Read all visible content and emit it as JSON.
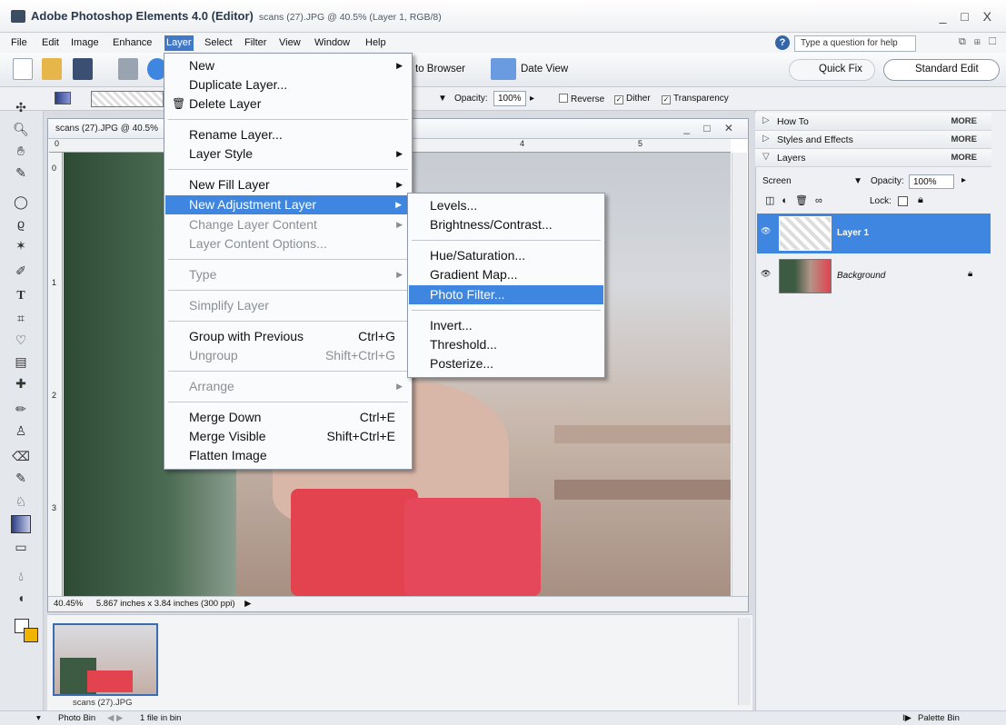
{
  "window": {
    "app_title": "Adobe Photoshop Elements 4.0 (Editor)",
    "doc_info": "scans (27).JPG @ 40.5% (Layer 1, RGB/8)",
    "controls": "_ □ X"
  },
  "menubar": {
    "items": [
      "File",
      "Edit",
      "Image",
      "Enhance",
      "Layer",
      "Select",
      "Filter",
      "View",
      "Window",
      "Help"
    ],
    "help_placeholder": "Type a question for help",
    "right_icons": "⧉ ⊞ ☐"
  },
  "toolbar": {
    "photo_browser": "to Browser",
    "date_view": "Date View",
    "quick_fix": "Quick Fix",
    "standard_edit": "Standard Edit"
  },
  "options": {
    "opacity_label": "Opacity:",
    "opacity_value": "100%",
    "reverse": "Reverse",
    "dither": "Dither",
    "transparency": "Transparency"
  },
  "document": {
    "title": "scans (27).JPG @ 40.5%",
    "zoom": "40.45%",
    "size_info": "5.867 inches x 3.84 inches (300 ppi)",
    "ruler_top": [
      "0",
      "4",
      "5"
    ],
    "ruler_left": [
      "0",
      "1",
      "2",
      "3"
    ]
  },
  "layer_menu": {
    "items": [
      {
        "label": "New",
        "submenu": true
      },
      {
        "label": "Duplicate Layer..."
      },
      {
        "label": "Delete Layer"
      },
      {
        "label": "Rename Layer..."
      },
      {
        "label": "Layer Style",
        "submenu": true
      },
      {
        "label": "New Fill Layer",
        "submenu": true
      },
      {
        "label": "New Adjustment Layer",
        "submenu": true
      },
      {
        "label": "Change Layer Content",
        "submenu": true
      },
      {
        "label": "Layer Content Options..."
      },
      {
        "label": "Type",
        "submenu": true
      },
      {
        "label": "Simplify Layer"
      },
      {
        "label": "Group with Previous",
        "shortcut": "Ctrl+G"
      },
      {
        "label": "Ungroup",
        "shortcut": "Shift+Ctrl+G"
      },
      {
        "label": "Arrange",
        "submenu": true
      },
      {
        "label": "Merge Down",
        "shortcut": "Ctrl+E"
      },
      {
        "label": "Merge Visible",
        "shortcut": "Shift+Ctrl+E"
      },
      {
        "label": "Flatten Image"
      }
    ]
  },
  "adjustment_menu": {
    "items": [
      "Levels...",
      "Brightness/Contrast...",
      "Hue/Saturation...",
      "Gradient Map...",
      "Photo Filter...",
      "Invert...",
      "Threshold...",
      "Posterize..."
    ]
  },
  "palette": {
    "how_to": "How To",
    "styles": "Styles and Effects",
    "layers": "Layers",
    "more": "MORE",
    "blend_mode": "Screen",
    "opacity_label": "Opacity:",
    "opacity_value": "100%",
    "lock_label": "Lock:",
    "layer1": "Layer 1",
    "background": "Background"
  },
  "photo_bin": {
    "thumb_label": "scans (27).JPG"
  },
  "status": {
    "photo_bin": "Photo Bin",
    "file_count": "1 file in bin",
    "palette_bin": "Palette Bin"
  },
  "colors": {
    "accent": "#3f86e0",
    "menu_active": "#3f79c8"
  }
}
